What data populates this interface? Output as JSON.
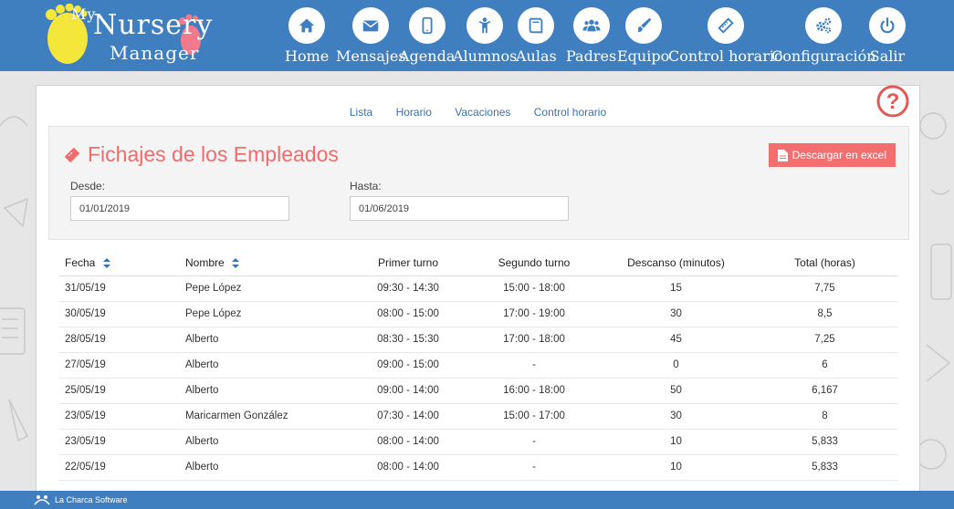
{
  "app": {
    "logo_my": "My",
    "logo_nursery": "Nursery",
    "logo_manager": "Manager",
    "footer_text": "La Charca Software"
  },
  "nav": [
    {
      "label": "Home",
      "icon": "home-icon"
    },
    {
      "label": "Mensajes",
      "icon": "envelope-icon"
    },
    {
      "label": "Agenda",
      "icon": "mobile-icon"
    },
    {
      "label": "Alumnos",
      "icon": "child-icon"
    },
    {
      "label": "Aulas",
      "icon": "book-icon"
    },
    {
      "label": "Padres",
      "icon": "users-icon"
    },
    {
      "label": "Equipo",
      "icon": "brush-icon"
    },
    {
      "label": "Control horario",
      "icon": "ticket-icon"
    },
    {
      "label": "Configuración",
      "icon": "gears-icon"
    },
    {
      "label": "Salir",
      "icon": "power-icon"
    }
  ],
  "subnav": [
    "Lista",
    "Horario",
    "Vacaciones",
    "Control horario"
  ],
  "panel": {
    "title": "Fichajes de los Empleados",
    "excel_button": "Descargar en excel",
    "desde_label": "Desde:",
    "desde_value": "01/01/2019",
    "hasta_label": "Hasta:",
    "hasta_value": "01/06/2019"
  },
  "table": {
    "headers": [
      "Fecha",
      "Nombre",
      "Primer turno",
      "Segundo turno",
      "Descanso (minutos)",
      "Total (horas)"
    ],
    "rows": [
      [
        "31/05/19",
        "Pepe López",
        "09:30 - 14:30",
        "15:00 - 18:00",
        "15",
        "7,75"
      ],
      [
        "30/05/19",
        "Pepe López",
        "08:00 - 15:00",
        "17:00 - 19:00",
        "30",
        "8,5"
      ],
      [
        "28/05/19",
        "Alberto",
        "08:30 - 15:30",
        "17:00 - 18:00",
        "45",
        "7,25"
      ],
      [
        "27/05/19",
        "Alberto",
        "09:00 - 15:00",
        "-",
        "0",
        "6"
      ],
      [
        "25/05/19",
        "Alberto",
        "09:00 - 14:00",
        "16:00 - 18:00",
        "50",
        "6,167"
      ],
      [
        "23/05/19",
        "Maricarmen González",
        "07:30 - 14:00",
        "15:00 - 17:00",
        "30",
        "8"
      ],
      [
        "23/05/19",
        "Alberto",
        "08:00 - 14:00",
        "-",
        "10",
        "5,833"
      ],
      [
        "22/05/19",
        "Alberto",
        "08:00 - 14:00",
        "-",
        "10",
        "5,833"
      ]
    ]
  },
  "colors": {
    "nav_blue": "#3f7fbf",
    "accent_red": "#f06b6b",
    "link_blue": "#3a72ad"
  }
}
